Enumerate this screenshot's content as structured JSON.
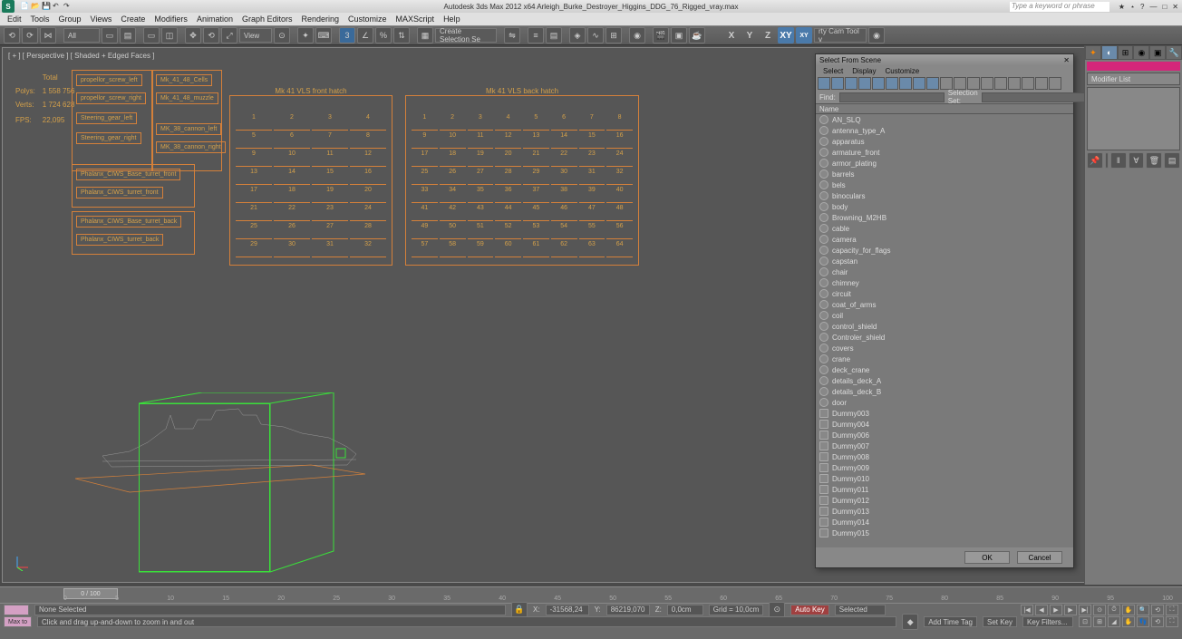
{
  "title": "Autodesk 3ds Max  2012 x64     Arleigh_Burke_Destroyer_Higgins_DDG_76_Rigged_vray.max",
  "search_placeholder": "Type a keyword or phrase",
  "menu": [
    "Edit",
    "Tools",
    "Group",
    "Views",
    "Create",
    "Modifiers",
    "Animation",
    "Graph Editors",
    "Rendering",
    "Customize",
    "MAXScript",
    "Help"
  ],
  "toolbar": {
    "selectionFilter": "All",
    "createSel": "Create Selection Se",
    "view": "View",
    "rtyCam": "rty Cam Tool v"
  },
  "viewport": {
    "label": "[ + ] [ Perspective ] [ Shaded + Edged Faces ]",
    "stats": {
      "polys_label": "Polys:",
      "polys_value": "1 558 756",
      "verts_label": "Verts:",
      "verts_value": "1 724 628",
      "fps_label": "FPS:",
      "fps_value": "22,095",
      "total_label": "Total"
    }
  },
  "bones_left": [
    "propellor_screw_left",
    "propellor_screw_right",
    "Steering_gear_left",
    "Steering_gear_right"
  ],
  "bones_mk": [
    "Mk_41_48_Cells",
    "Mk_41_48_muzzle",
    "MK_38_cannon_left",
    "MK_38_cannon_right"
  ],
  "bones_phalanx": [
    "Phalanx_CIWS_Base_turret_front",
    "Phalanx_CIWS_turret_front",
    "Phalanx_CIWS_Base_turret_back",
    "Phalanx_CIWS_turret_back"
  ],
  "vls_front": {
    "title": "Mk 41 VLS front hatch",
    "rows": 8,
    "cols": 4
  },
  "vls_back": {
    "title": "Mk 41 VLS back hatch",
    "rows": 8,
    "cols": 8
  },
  "dialog": {
    "title": "Select From Scene",
    "menu": [
      "Select",
      "Display",
      "Customize"
    ],
    "find_label": "Find:",
    "selset_label": "Selection Set:",
    "col": "Name",
    "items": [
      "AN_SLQ",
      "antenna_type_A",
      "apparatus",
      "armature_front",
      "armor_plating",
      "barrels",
      "bels",
      "binoculars",
      "body",
      "Browning_M2HB",
      "cable",
      "camera",
      "capacity_for_flags",
      "capstan",
      "chair",
      "chimney",
      "circuit",
      "coat_of_arms",
      "coil",
      "control_shield",
      "Controler_shield",
      "covers",
      "crane",
      "deck_crane",
      "details_deck_A",
      "details_deck_B",
      "door",
      "Dummy003",
      "Dummy004",
      "Dummy006",
      "Dummy007",
      "Dummy008",
      "Dummy009",
      "Dummy010",
      "Dummy011",
      "Dummy012",
      "Dummy013",
      "Dummy014",
      "Dummy015"
    ],
    "ok": "OK",
    "cancel": "Cancel"
  },
  "cmd": {
    "modifier_list": "Modifier List"
  },
  "timeline": {
    "slider": "0 / 100",
    "ticks": [
      "0",
      "5",
      "10",
      "15",
      "20",
      "25",
      "30",
      "35",
      "40",
      "45",
      "50",
      "55",
      "60",
      "65",
      "70",
      "75",
      "80",
      "85",
      "90",
      "95",
      "100"
    ]
  },
  "status": {
    "maxto": "Max  to",
    "none": "None Selected",
    "prompt": "Click and drag up-and-down to zoom in and out",
    "x_label": "X:",
    "x_val": "-31568,24",
    "y_label": "Y:",
    "y_val": "86219,070",
    "z_label": "Z:",
    "z_val": "0,0cm",
    "grid": "Grid = 10,0cm",
    "addtime": "Add Time Tag",
    "autokey": "Auto Key",
    "setkey": "Set Key",
    "selected": "Selected",
    "keyfilters": "Key Filters..."
  }
}
